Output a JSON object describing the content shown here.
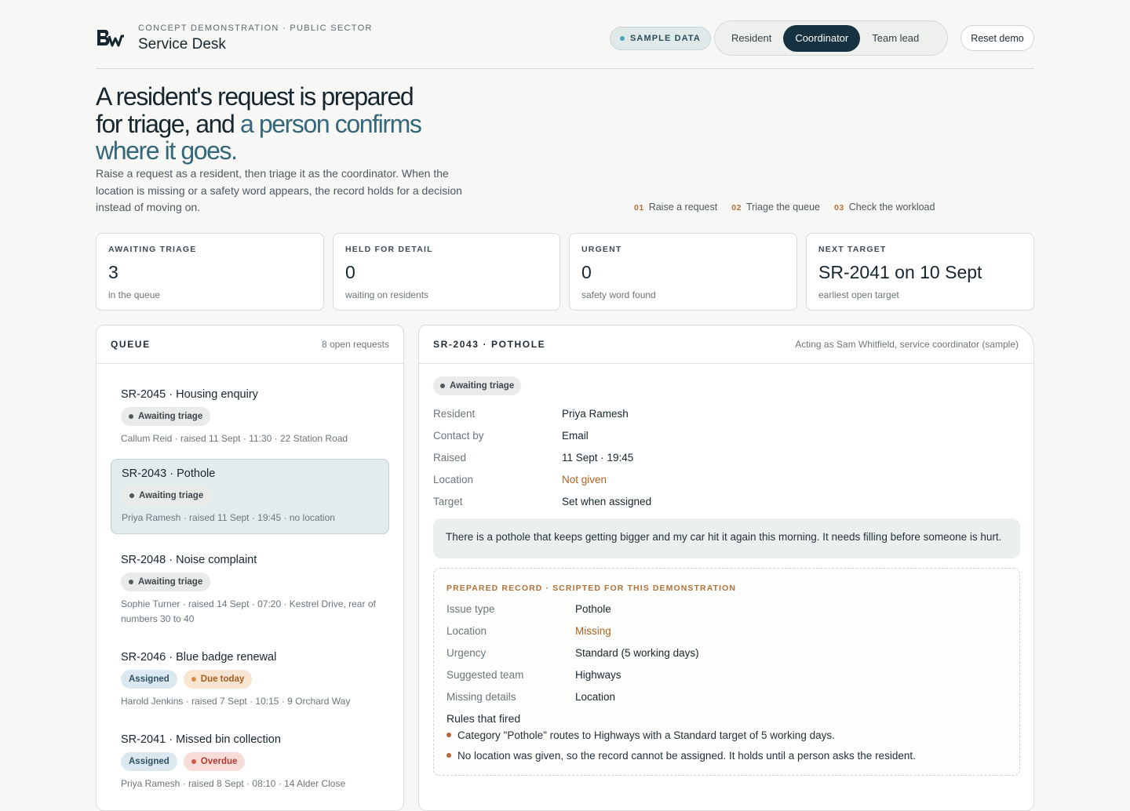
{
  "header": {
    "eyebrow": "CONCEPT DEMONSTRATION · PUBLIC SECTOR",
    "title": "Service Desk",
    "sample_label": "SAMPLE DATA",
    "roles": [
      "Resident",
      "Coordinator",
      "Team lead"
    ],
    "active_role": "Coordinator",
    "reset_label": "Reset demo"
  },
  "hero": {
    "title_part1": "A resident's request is prepared for triage, and ",
    "title_accent": "a person confirms where it goes.",
    "description": "Raise a request as a resident, then triage it as the coordinator. When the location is missing or a safety word appears, the record holds for a decision instead of moving on.",
    "steps": [
      {
        "num": "01",
        "label": "Raise a request"
      },
      {
        "num": "02",
        "label": "Triage the queue"
      },
      {
        "num": "03",
        "label": "Check the workload"
      }
    ]
  },
  "stats": [
    {
      "label": "AWAITING TRIAGE",
      "value": "3",
      "sub": "in the queue"
    },
    {
      "label": "HELD FOR DETAIL",
      "value": "0",
      "sub": "waiting on residents"
    },
    {
      "label": "URGENT",
      "value": "0",
      "sub": "safety word found"
    },
    {
      "label": "NEXT TARGET",
      "value": "SR-2041 on 10 Sept",
      "sub": "earliest open target"
    }
  ],
  "queue": {
    "title": "QUEUE",
    "count": "8 open requests",
    "items": [
      {
        "title": "SR-2045 · Housing enquiry",
        "badges": [
          "Awaiting triage"
        ],
        "meta": "Callum Reid · raised 11 Sept · 11:30 · 22 Station Road"
      },
      {
        "title": "SR-2043 · Pothole",
        "badges": [
          "Awaiting triage"
        ],
        "meta": "Priya Ramesh · raised 11 Sept · 19:45 · no location"
      },
      {
        "title": "SR-2048 · Noise complaint",
        "badges": [
          "Awaiting triage"
        ],
        "meta": "Sophie Turner · raised 14 Sept · 07:20 · Kestrel Drive, rear of numbers 30 to 40"
      },
      {
        "title": "SR-2046 · Blue badge renewal",
        "badges": [
          "Assigned",
          "Due today"
        ],
        "meta": "Harold Jenkins · raised 7 Sept · 10:15 · 9 Orchard Way"
      },
      {
        "title": "SR-2041 · Missed bin collection",
        "badges": [
          "Assigned",
          "Overdue"
        ],
        "meta": "Priya Ramesh · raised 8 Sept · 08:10 · 14 Alder Close"
      }
    ]
  },
  "detail": {
    "title": "SR-2043 · POTHOLE",
    "acting_as": "Acting as Sam Whitfield, service coordinator (sample)",
    "status": "Awaiting triage",
    "fields": [
      {
        "k": "Resident",
        "v": "Priya Ramesh"
      },
      {
        "k": "Contact by",
        "v": "Email"
      },
      {
        "k": "Raised",
        "v": "11 Sept · 19:45"
      },
      {
        "k": "Location",
        "v": "Not given"
      },
      {
        "k": "Target",
        "v": "Set when assigned"
      }
    ],
    "message": "There is a pothole that keeps getting bigger and my car hit it again this morning. It needs filling before someone is hurt.",
    "prepared": {
      "heading": "PREPARED RECORD · SCRIPTED FOR THIS DEMONSTRATION",
      "fields": [
        {
          "k": "Issue type",
          "v": "Pothole"
        },
        {
          "k": "Location",
          "v": "Missing"
        },
        {
          "k": "Urgency",
          "v": "Standard (5 working days)"
        },
        {
          "k": "Suggested team",
          "v": "Highways"
        },
        {
          "k": "Missing details",
          "v": "Location"
        }
      ],
      "rules_title": "Rules that fired",
      "rules": [
        "Category \"Pothole\" routes to Highways with a Standard target of 5 working days.",
        "No location was given, so the record cannot be assigned. It holds until a person asks the resident."
      ]
    }
  }
}
